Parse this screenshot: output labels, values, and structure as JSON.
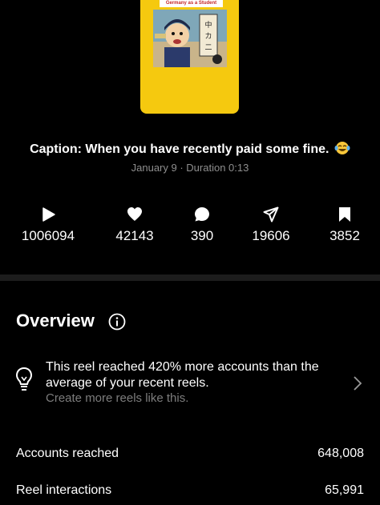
{
  "thumbnail": {
    "banner_text": "Germany as a Student"
  },
  "post": {
    "caption": "Caption: When you have recently paid some fine.",
    "caption_emoji": "laughing-tears-emoji",
    "meta": "January 9 · Duration 0:13"
  },
  "stats": [
    {
      "icon": "play-icon",
      "value": "1006094"
    },
    {
      "icon": "heart-icon",
      "value": "42143"
    },
    {
      "icon": "comment-icon",
      "value": "390"
    },
    {
      "icon": "share-icon",
      "value": "19606"
    },
    {
      "icon": "bookmark-icon",
      "value": "3852"
    }
  ],
  "overview": {
    "title": "Overview",
    "insight_text": "This reel reached 420% more accounts than the average of your recent reels.",
    "insight_link": "Create more reels like this."
  },
  "metrics": [
    {
      "label": "Accounts reached",
      "value": "648,008"
    },
    {
      "label": "Reel interactions",
      "value": "65,991"
    }
  ],
  "colors": {
    "background": "#000000",
    "thumbnail_yellow": "#f5c90f",
    "secondary_text": "#8e8e8e"
  }
}
